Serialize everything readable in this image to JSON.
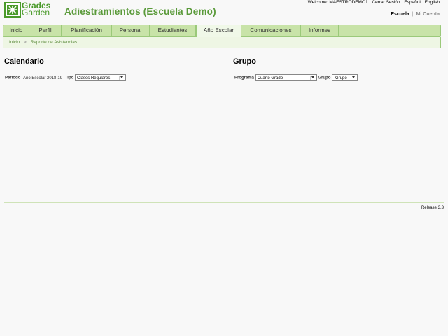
{
  "brand": {
    "line1": "Grades",
    "line2": "Garden"
  },
  "app": {
    "title": "Adiestramientos (Escuela Demo)"
  },
  "topbar": {
    "welcome": "Welcome: MAESTRODEMO1",
    "links": [
      "Cerrar Sesión",
      "Español",
      "English"
    ]
  },
  "context": {
    "active": "Escuela",
    "separator": "|",
    "inactive": "Mi Cuenta"
  },
  "nav": {
    "items": [
      {
        "label": "Inicio"
      },
      {
        "label": "Perfil"
      },
      {
        "label": "Planificación"
      },
      {
        "label": "Personal"
      },
      {
        "label": "Estudiantes"
      },
      {
        "label": "Año Escolar"
      },
      {
        "label": "Comunicaciones"
      },
      {
        "label": "Informes"
      }
    ],
    "active_index": 5
  },
  "breadcrumb": {
    "home": "Inicio",
    "separator": ">",
    "current": "Reporte de Asistencias"
  },
  "calendario": {
    "title": "Calendario",
    "periodo_label": "Periodo",
    "periodo_value": "Año Escolar 2018-19",
    "tipo_label": "Tipo",
    "tipo_selected": "Clases Regulares"
  },
  "grupo": {
    "title": "Grupo",
    "programa_label": "Programa",
    "programa_selected": "Cuarto Grado",
    "grupo_label": "Grupo",
    "grupo_selected": "-Grupo-"
  },
  "footer": {
    "release": "Release 3.3"
  },
  "colors": {
    "accent": "#5a9a3a",
    "nav_bg": "#c8e3a8",
    "nav_border": "#9bc97a"
  }
}
